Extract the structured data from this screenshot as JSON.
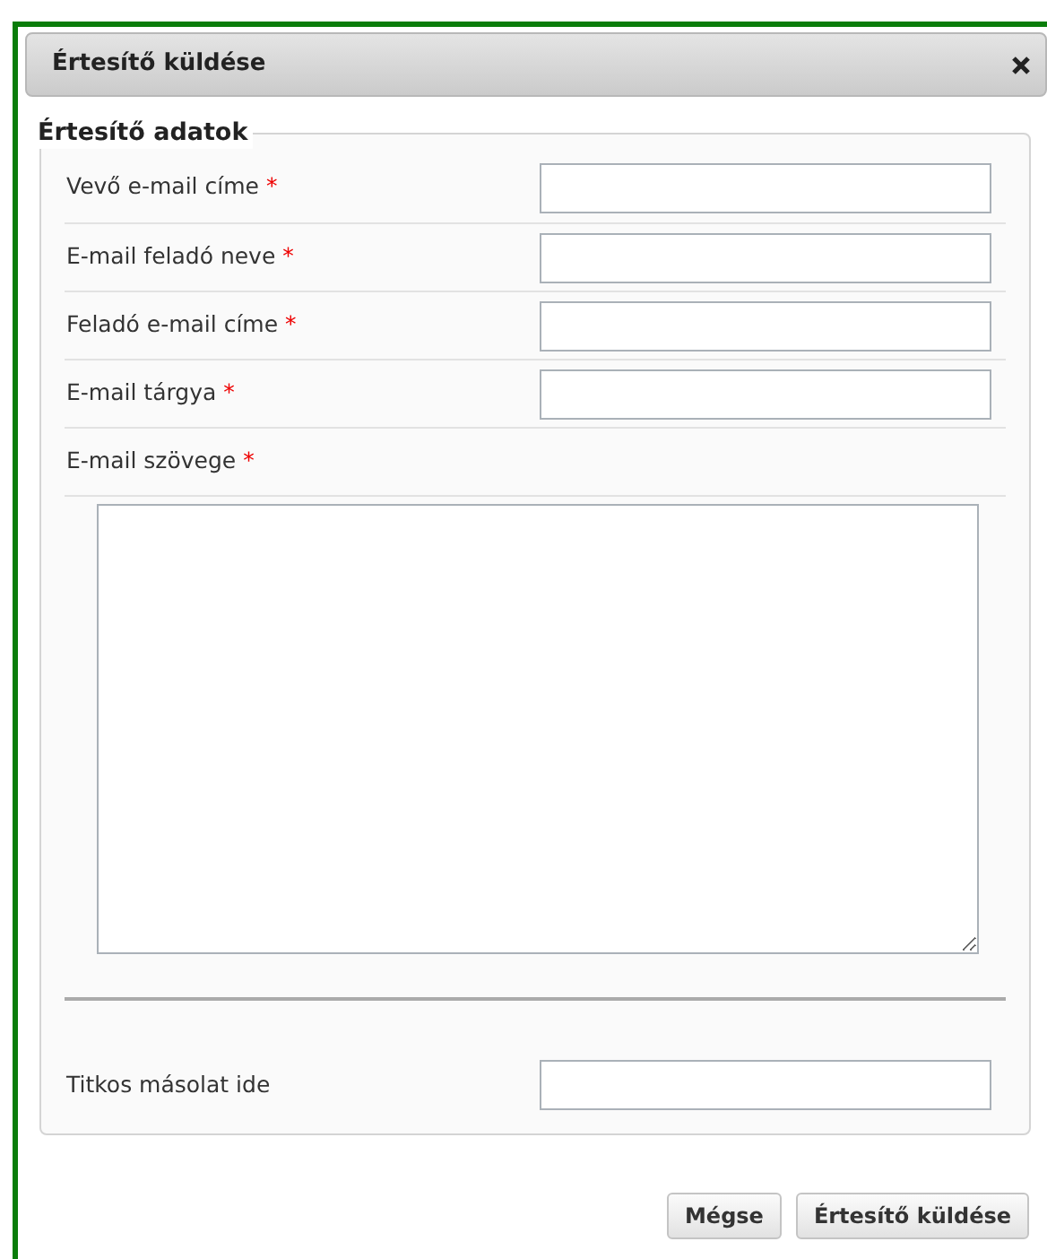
{
  "dialog": {
    "title": "Értesítő küldése"
  },
  "fieldset": {
    "legend": "Értesítő adatok",
    "fields": [
      {
        "kind": "input",
        "label": "Vevő e-mail címe",
        "required_mark": "*"
      },
      {
        "kind": "input",
        "label": "E-mail feladó neve",
        "required_mark": "*"
      },
      {
        "kind": "input",
        "label": "Feladó e-mail címe",
        "required_mark": "*"
      },
      {
        "kind": "input",
        "label": "E-mail tárgya",
        "required_mark": "*"
      },
      {
        "kind": "textarea",
        "label": "E-mail szövege",
        "required_mark": "*"
      },
      {
        "kind": "separator"
      },
      {
        "kind": "input",
        "label": "Titkos másolat ide"
      }
    ]
  },
  "buttons": [
    {
      "label": "Mégse"
    },
    {
      "label": "Értesítő küldése"
    }
  ]
}
